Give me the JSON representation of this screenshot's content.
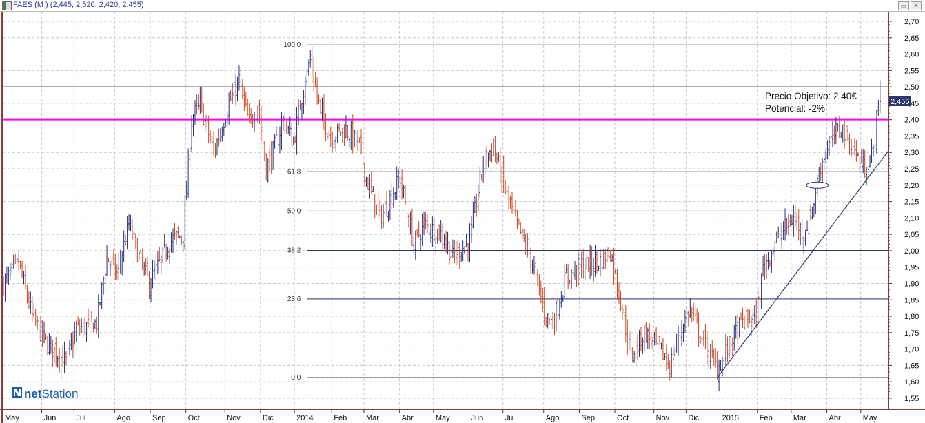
{
  "window": {
    "title": "FAES (M ) (2,445, 2,520, 2,420, 2,455)",
    "restore_icon": "restore-icon",
    "close_icon": "close-icon"
  },
  "logo": {
    "part1": "net",
    "part2": "Station"
  },
  "annotation": {
    "line1": "Precio Objetivo: 2,40€",
    "line2": "Potencial: -2%"
  },
  "last_price_label": "2,455",
  "colors": {
    "up": "#26307e",
    "down": "#d2461a",
    "target": "#ff00ff",
    "level": "#2c3570",
    "axis_border": "#8b3a3a"
  },
  "chart_data": {
    "type": "ohlc",
    "symbol": "FAES",
    "ylim": [
      1.55,
      2.7
    ],
    "yticks": [
      "2,70",
      "2,65",
      "2,60",
      "2,55",
      "2,50",
      "2,45",
      "2,40",
      "2,35",
      "2,30",
      "2,25",
      "2,20",
      "2,15",
      "2,10",
      "2,05",
      "2,00",
      "1,95",
      "1,90",
      "1,85",
      "1,80",
      "1,75",
      "1,70",
      "1,65",
      "1,60",
      "1,55"
    ],
    "yvalues": [
      2.7,
      2.65,
      2.6,
      2.55,
      2.5,
      2.45,
      2.4,
      2.35,
      2.3,
      2.25,
      2.2,
      2.15,
      2.1,
      2.05,
      2.0,
      1.95,
      1.9,
      1.85,
      1.8,
      1.75,
      1.7,
      1.65,
      1.6,
      1.55
    ],
    "total_days": 518,
    "months": [
      {
        "label": "May",
        "day": 0
      },
      {
        "label": "Jun",
        "day": 23
      },
      {
        "label": "Jul",
        "day": 42
      },
      {
        "label": "Ago",
        "day": 66
      },
      {
        "label": "Sep",
        "day": 87
      },
      {
        "label": "Oct",
        "day": 108
      },
      {
        "label": "Nov",
        "day": 131
      },
      {
        "label": "Dic",
        "day": 152
      },
      {
        "label": "2014",
        "day": 172
      },
      {
        "label": "Feb",
        "day": 194
      },
      {
        "label": "Mar",
        "day": 213
      },
      {
        "label": "Abr",
        "day": 234
      },
      {
        "label": "May",
        "day": 254
      },
      {
        "label": "Jun",
        "day": 275
      },
      {
        "label": "Jul",
        "day": 295
      },
      {
        "label": "Ago",
        "day": 319
      },
      {
        "label": "Sep",
        "day": 340
      },
      {
        "label": "Oct",
        "day": 361
      },
      {
        "label": "Nov",
        "day": 384
      },
      {
        "label": "Dic",
        "day": 403
      },
      {
        "label": "2015",
        "day": 423
      },
      {
        "label": "Feb",
        "day": 445
      },
      {
        "label": "Mar",
        "day": 465
      },
      {
        "label": "Abr",
        "day": 486
      },
      {
        "label": "May",
        "day": 506
      }
    ],
    "close_path": [
      [
        0,
        1.9
      ],
      [
        9,
        1.96
      ],
      [
        17,
        1.8
      ],
      [
        25,
        1.72
      ],
      [
        37,
        1.66
      ],
      [
        43,
        1.76
      ],
      [
        55,
        1.78
      ],
      [
        61,
        1.98
      ],
      [
        67,
        1.93
      ],
      [
        74,
        2.08
      ],
      [
        80,
        1.98
      ],
      [
        86,
        1.9
      ],
      [
        94,
        1.98
      ],
      [
        98,
        2.03
      ],
      [
        106,
        2.05
      ],
      [
        111,
        2.4
      ],
      [
        116,
        2.45
      ],
      [
        124,
        2.3
      ],
      [
        133,
        2.45
      ],
      [
        139,
        2.52
      ],
      [
        145,
        2.38
      ],
      [
        150,
        2.45
      ],
      [
        155,
        2.25
      ],
      [
        161,
        2.33
      ],
      [
        165,
        2.4
      ],
      [
        171,
        2.33
      ],
      [
        177,
        2.5
      ],
      [
        181,
        2.58
      ],
      [
        187,
        2.42
      ],
      [
        193,
        2.35
      ],
      [
        202,
        2.37
      ],
      [
        210,
        2.32
      ],
      [
        214,
        2.22
      ],
      [
        222,
        2.1
      ],
      [
        234,
        2.22
      ],
      [
        242,
        2.02
      ],
      [
        248,
        2.08
      ],
      [
        259,
        2.05
      ],
      [
        265,
        1.98
      ],
      [
        275,
        2.03
      ],
      [
        283,
        2.27
      ],
      [
        289,
        2.32
      ],
      [
        295,
        2.2
      ],
      [
        301,
        2.1
      ],
      [
        311,
        1.98
      ],
      [
        320,
        1.8
      ],
      [
        324,
        1.78
      ],
      [
        332,
        1.92
      ],
      [
        340,
        1.95
      ],
      [
        352,
        1.97
      ],
      [
        358,
        2.0
      ],
      [
        364,
        1.85
      ],
      [
        370,
        1.68
      ],
      [
        378,
        1.75
      ],
      [
        387,
        1.7
      ],
      [
        393,
        1.65
      ],
      [
        401,
        1.78
      ],
      [
        405,
        1.82
      ],
      [
        413,
        1.72
      ],
      [
        421,
        1.64
      ],
      [
        427,
        1.7
      ],
      [
        435,
        1.78
      ],
      [
        444,
        1.8
      ],
      [
        448,
        1.95
      ],
      [
        458,
        2.05
      ],
      [
        466,
        2.1
      ],
      [
        472,
        2.05
      ],
      [
        478,
        2.15
      ],
      [
        482,
        2.26
      ],
      [
        486,
        2.32
      ],
      [
        494,
        2.38
      ],
      [
        500,
        2.32
      ],
      [
        508,
        2.25
      ],
      [
        513,
        2.3
      ],
      [
        515,
        2.4
      ],
      [
        517,
        2.455
      ]
    ],
    "last_bar": {
      "open": 2.445,
      "high": 2.52,
      "low": 2.42,
      "close": 2.455
    },
    "fibonacci": {
      "start_day": 179,
      "levels": [
        {
          "label": "100.0",
          "price": 2.628
        },
        {
          "label": "61.8",
          "price": 2.241
        },
        {
          "label": "50.0",
          "price": 2.121
        },
        {
          "label": "38.2",
          "price": 2.001
        },
        {
          "label": "23.6",
          "price": 1.853
        },
        {
          "label": "0.0",
          "price": 1.613
        }
      ]
    },
    "horizontal_lines": [
      2.5,
      2.35
    ],
    "target_line": 2.4,
    "trendline": {
      "from": [
        421,
        1.613
      ],
      "to": [
        522,
        2.305
      ]
    },
    "marker_ellipse": {
      "day": 480,
      "price": 2.2
    }
  }
}
